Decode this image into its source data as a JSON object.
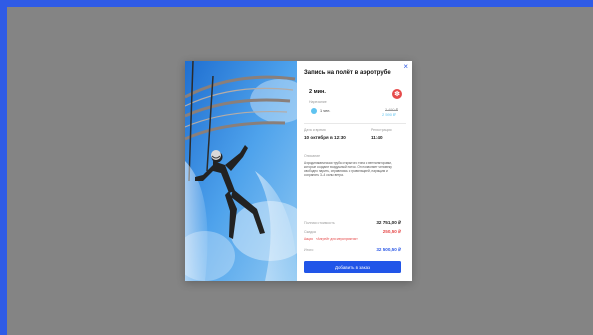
{
  "modal": {
    "title": "Запись на полёт в аэротрубе",
    "close_glyph": "×",
    "duration": "2 мин.",
    "duration_label": "Нарезание",
    "badge_glyph": "✽",
    "passengers": "1 чел.",
    "price_old": "3 490 ₽",
    "price_new": "2 590 ₽",
    "date_label": "Дата и время",
    "date_value": "10 октября в 12:30",
    "reg_label": "Регистрация",
    "reg_value": "11:40",
    "desc_label": "Описание",
    "desc_text": "Аэродинамическая труба открытого типа с вентиляторами, которые создают воздушный поток. Он позволяет человеку свободно парить, справляясь с гравитацией, парящим и сохранять 3–4 силы ветра.",
    "subtotal_label": "Полная стоимость",
    "subtotal_value": "32 751,00 ₽",
    "discount_label": "Скидка",
    "discount_value": "250,50 ₽",
    "promo_type": "Акция",
    "promo_name": "«Апгрейт для мероприятия»",
    "total_label": "Итого",
    "total_value": "32 500,50 ₽",
    "add_button": "Добавить в заказ"
  },
  "colors": {
    "page_frame": "#2f5be6",
    "backdrop": "#848484",
    "accent": "#2155e8",
    "discount": "#e64b4b",
    "price_new": "#5fc3f0"
  }
}
